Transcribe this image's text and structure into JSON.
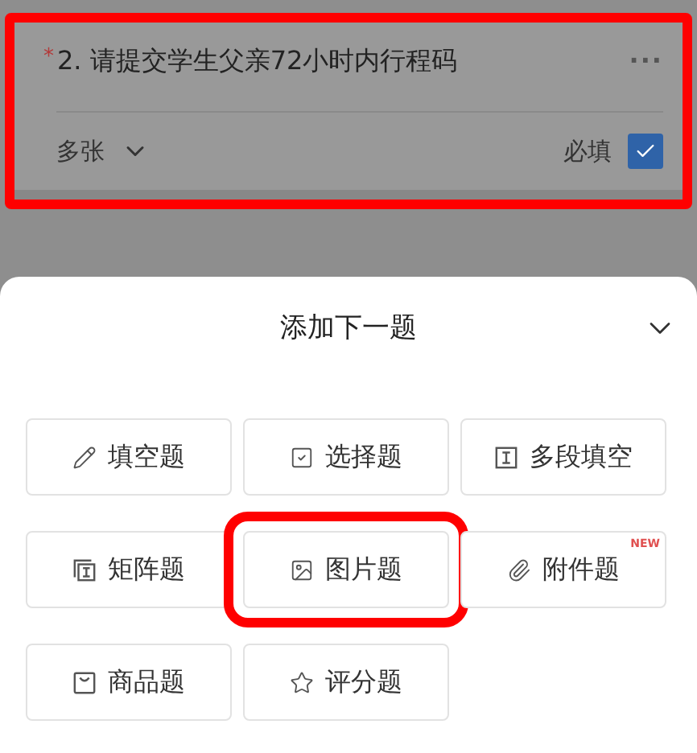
{
  "question": {
    "required_mark": "*",
    "title": "2. 请提交学生父亲72小时内行程码",
    "more": "···",
    "mode": "多张",
    "required_label": "必填",
    "required": true,
    "highlighted": true
  },
  "sheet": {
    "title": "添加下一题",
    "types": [
      {
        "kind": "blank",
        "label": "填空题",
        "highlighted": false
      },
      {
        "kind": "choice",
        "label": "选择题",
        "highlighted": false
      },
      {
        "kind": "multi_blank",
        "label": "多段填空",
        "highlighted": false
      },
      {
        "kind": "matrix",
        "label": "矩阵题",
        "highlighted": false
      },
      {
        "kind": "image",
        "label": "图片题",
        "highlighted": true
      },
      {
        "kind": "attachment",
        "label": "附件题",
        "highlighted": false,
        "badge": "NEW"
      },
      {
        "kind": "product",
        "label": "商品题",
        "highlighted": false
      },
      {
        "kind": "rating",
        "label": "评分题",
        "highlighted": false
      }
    ]
  }
}
